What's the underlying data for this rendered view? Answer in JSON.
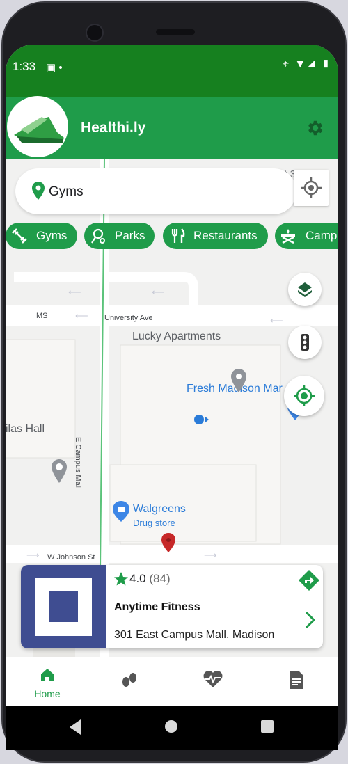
{
  "status_bar": {
    "time": "1:33"
  },
  "app": {
    "title": "Healthi.ly"
  },
  "search": {
    "value": "Gyms"
  },
  "chips": [
    {
      "label": "Gyms",
      "icon": "dumbbell-icon"
    },
    {
      "label": "Parks",
      "icon": "park-icon"
    },
    {
      "label": "Restaurants",
      "icon": "fork-knife-icon"
    },
    {
      "label": "Camp",
      "icon": "campfire-icon"
    }
  ],
  "map": {
    "labels": {
      "ms": "MS",
      "university_ave": "University Ave",
      "lucky_apartments": "Lucky Apartments",
      "fresh_madison": "Fresh Madison Mar",
      "hall": "ilas Hall",
      "walgreens": "Walgreens",
      "drug_store": "Drug store",
      "johnson_st": "W Johnson St",
      "campus_mall": "E Campus Mall",
      "top_partial": "nt 3"
    }
  },
  "card": {
    "rating": "4.0",
    "rating_count": "(84)",
    "title": "Anytime Fitness",
    "address": "301 East Campus Mall, Madison"
  },
  "bottom_nav": {
    "items": [
      {
        "label": "Home",
        "icon": "home-icon",
        "active": true
      },
      {
        "label": "",
        "icon": "footsteps-icon"
      },
      {
        "label": "",
        "icon": "heartbeat-icon"
      },
      {
        "label": "",
        "icon": "document-icon"
      }
    ]
  },
  "colors": {
    "primary": "#1f9c4a",
    "status": "#16801f",
    "thumb": "#3f4d91"
  }
}
